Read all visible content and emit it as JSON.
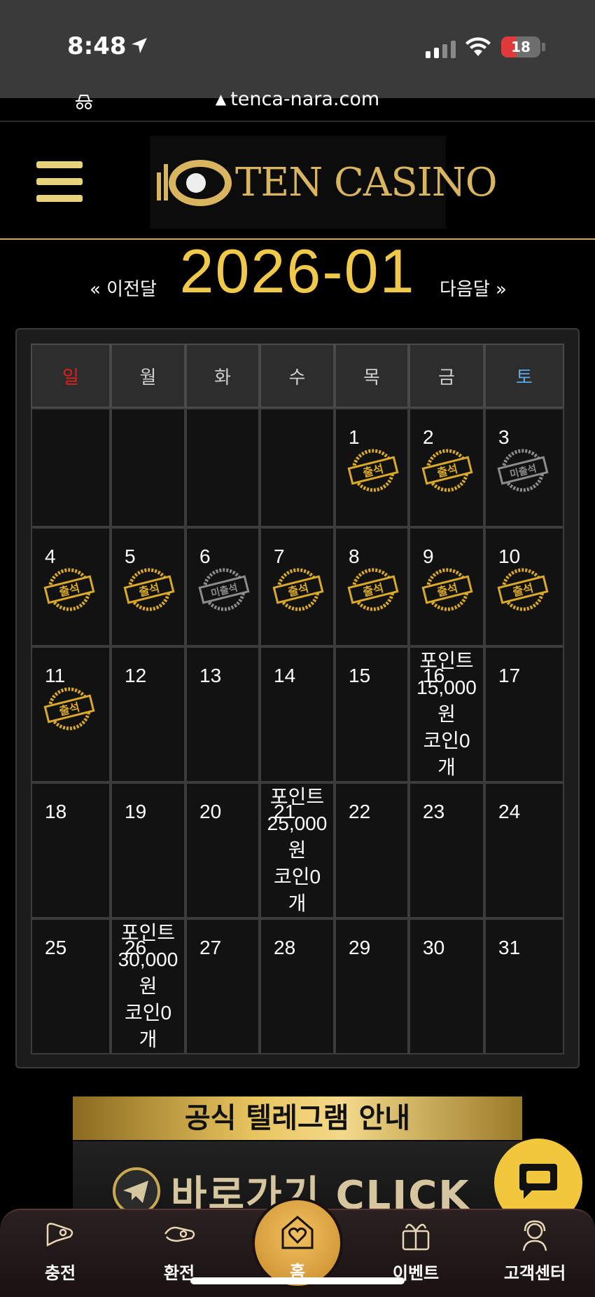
{
  "status": {
    "time": "8:48",
    "battery": "18"
  },
  "browser": {
    "url": "tenca-nara.com"
  },
  "header": {
    "logo_text": "TEN CASINO"
  },
  "calendar": {
    "prev_label": "« 이전달",
    "title": "2026-01",
    "next_label": "다음달 »",
    "weekdays": [
      "일",
      "월",
      "화",
      "수",
      "목",
      "금",
      "토"
    ],
    "weekday_colors": {
      "sun": "#e02020",
      "sat": "#5aa8e8",
      "default": "#cfcfcf"
    },
    "days": {
      "d1": "1",
      "d2": "2",
      "d3": "3",
      "d4": "4",
      "d5": "5",
      "d6": "6",
      "d7": "7",
      "d8": "8",
      "d9": "9",
      "d10": "10",
      "d11": "11",
      "d12": "12",
      "d13": "13",
      "d14": "14",
      "d15": "15",
      "d16": "16",
      "d17": "17",
      "d18": "18",
      "d19": "19",
      "d20": "20",
      "d21": "21",
      "d22": "22",
      "d23": "23",
      "d24": "24",
      "d25": "25",
      "d26": "26",
      "d27": "27",
      "d28": "28",
      "d29": "29",
      "d30": "30",
      "d31": "31"
    },
    "stamps": {
      "attended": "출석",
      "absent": "미출석",
      "attended_color": "#d9a92a",
      "absent_color": "#8c8c8c"
    },
    "notes": {
      "d16": {
        "l1": "포인트",
        "l2": "15,000",
        "l3": "원",
        "l4": "코인0",
        "l5": "개"
      },
      "d21": {
        "l1": "포인트",
        "l2": "25,000",
        "l3": "원",
        "l4": "코인0",
        "l5": "개"
      },
      "d26": {
        "l1": "포인트",
        "l2": "30,000",
        "l3": "원",
        "l4": "코인0",
        "l5": "개"
      }
    }
  },
  "banner": {
    "title": "공식 텔레그램 안내",
    "cta": "바로가기 CLICK"
  },
  "bottom_nav": {
    "charge": "충전",
    "exchange": "환전",
    "home": "홈",
    "event": "이벤트",
    "support": "고객센터"
  },
  "colors": {
    "gold": "#f0c94a",
    "chat": "#f2c73b"
  }
}
